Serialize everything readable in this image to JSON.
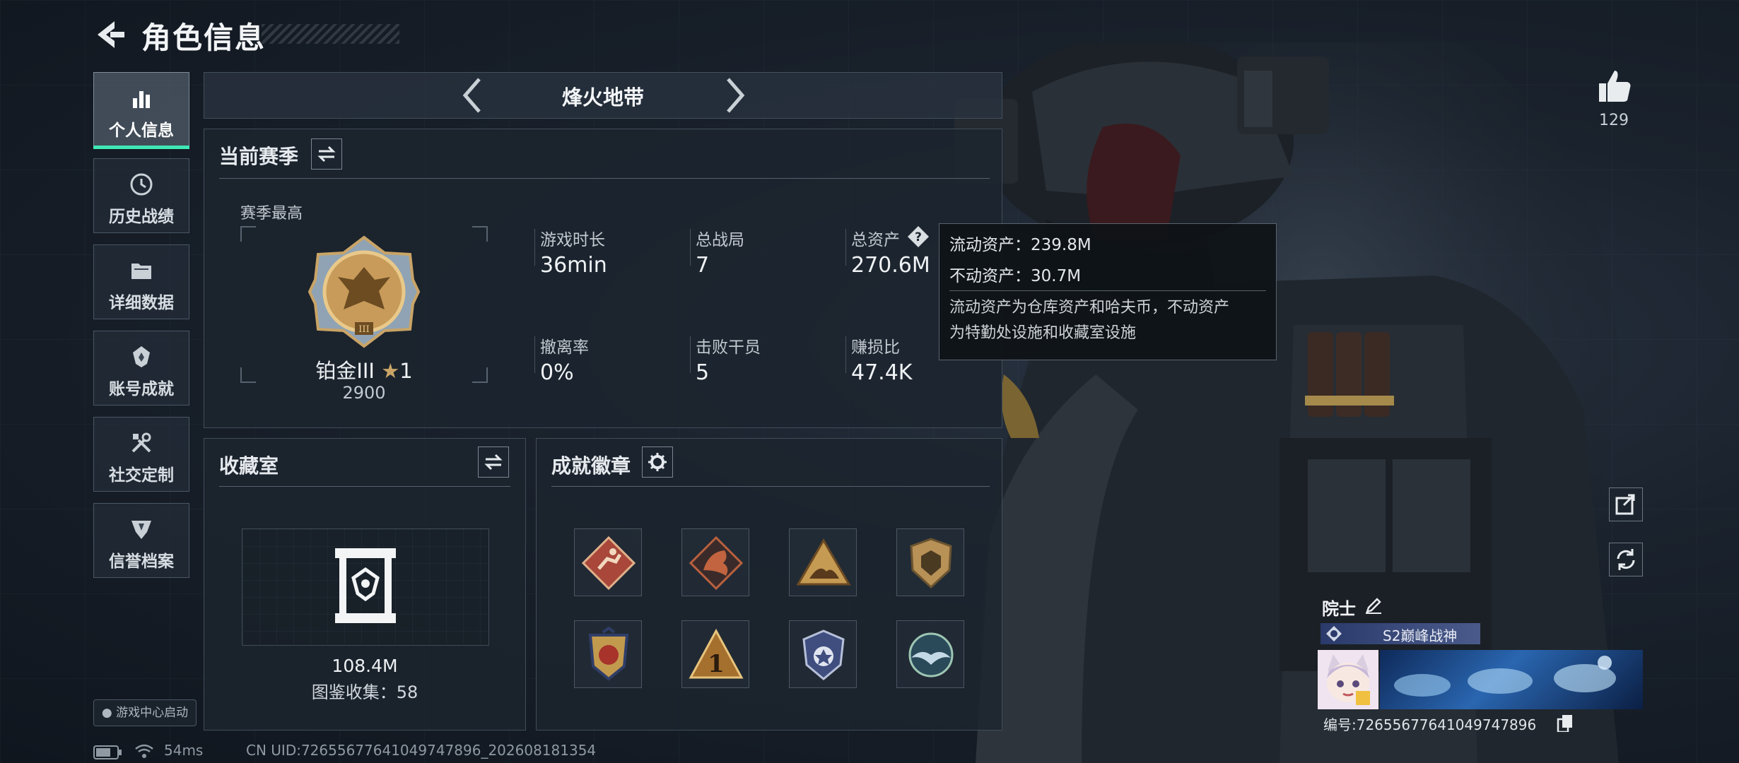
{
  "header": {
    "title": "角色信息"
  },
  "sidebar": {
    "items": [
      {
        "label": "个人信息",
        "icon": "bar-chart-icon",
        "active": true
      },
      {
        "label": "历史战绩",
        "icon": "history-clock-icon",
        "active": false
      },
      {
        "label": "详细数据",
        "icon": "folder-icon",
        "active": false
      },
      {
        "label": "账号成就",
        "icon": "achievement-icon",
        "active": false
      },
      {
        "label": "社交定制",
        "icon": "tools-icon",
        "active": false
      },
      {
        "label": "信誉档案",
        "icon": "credit-shield-icon",
        "active": false
      }
    ],
    "launch_badge": "游戏中心启动"
  },
  "mode_nav": {
    "name": "烽火地带"
  },
  "season": {
    "title": "当前赛季",
    "best_label": "赛季最高",
    "rank_name": "铂金III",
    "rank_stars": "1",
    "rank_score": "2900",
    "stats": [
      {
        "label": "游戏时长",
        "value": "36min"
      },
      {
        "label": "总战局",
        "value": "7"
      },
      {
        "label": "总资产",
        "value": "270.6M"
      },
      {
        "label": "撤离率",
        "value": "0%"
      },
      {
        "label": "击败干员",
        "value": "5"
      },
      {
        "label": "赚损比",
        "value": "47.4K"
      }
    ]
  },
  "tooltip": {
    "liquid": "流动资产：239.8M",
    "fixed": "不动资产：30.7M",
    "desc_line1": "流动资产为仓库资产和哈夫币，不动资产",
    "desc_line2": "为特勤处设施和收藏室设施"
  },
  "collection": {
    "title": "收藏室",
    "value": "108.4M",
    "codex": "图鉴收集：58"
  },
  "achievements": {
    "title": "成就徽章",
    "badges": [
      "runner-badge-icon",
      "dragon-badge-icon",
      "hill-badge-icon",
      "shield-badge-icon",
      "medal-badge-icon",
      "number-one-badge-icon",
      "star-shield-badge-icon",
      "wings-badge-icon"
    ]
  },
  "likes": {
    "count": "129"
  },
  "profile": {
    "title_name": "院士",
    "season_tag": "S2巅峰战神",
    "id_text": "编号:7265567764104974789​6"
  },
  "status": {
    "ping": "54ms",
    "uid": "CN UID:7265567764104974789​6_202608181354"
  },
  "colors": {
    "accent": "#3fe8b6",
    "panel": "#1c242e",
    "gold": "#c9a466"
  }
}
